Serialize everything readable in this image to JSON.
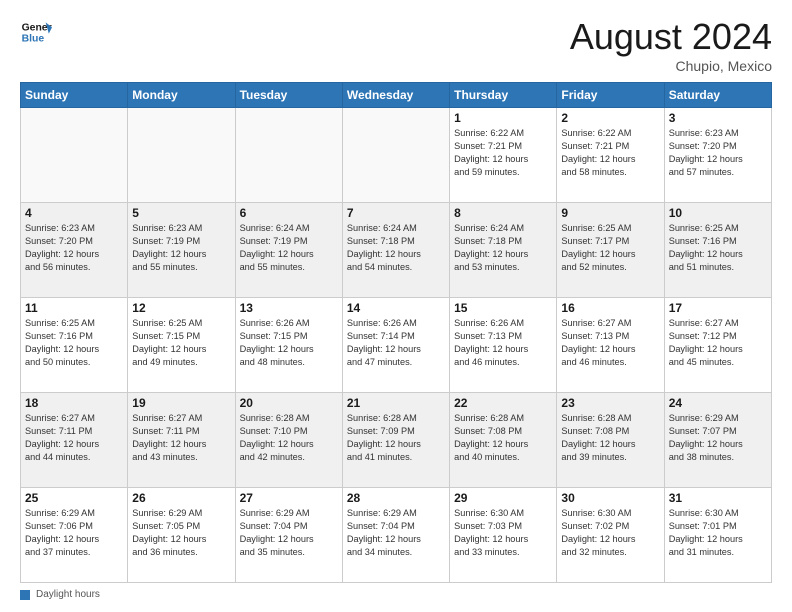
{
  "header": {
    "logo_line1": "General",
    "logo_line2": "Blue",
    "month_title": "August 2024",
    "subtitle": "Chupio, Mexico"
  },
  "days_of_week": [
    "Sunday",
    "Monday",
    "Tuesday",
    "Wednesday",
    "Thursday",
    "Friday",
    "Saturday"
  ],
  "footer": {
    "label": "Daylight hours"
  },
  "weeks": [
    {
      "days": [
        {
          "num": "",
          "info": "",
          "empty": true
        },
        {
          "num": "",
          "info": "",
          "empty": true
        },
        {
          "num": "",
          "info": "",
          "empty": true
        },
        {
          "num": "",
          "info": "",
          "empty": true
        },
        {
          "num": "1",
          "info": "Sunrise: 6:22 AM\nSunset: 7:21 PM\nDaylight: 12 hours\nand 59 minutes."
        },
        {
          "num": "2",
          "info": "Sunrise: 6:22 AM\nSunset: 7:21 PM\nDaylight: 12 hours\nand 58 minutes."
        },
        {
          "num": "3",
          "info": "Sunrise: 6:23 AM\nSunset: 7:20 PM\nDaylight: 12 hours\nand 57 minutes."
        }
      ]
    },
    {
      "days": [
        {
          "num": "4",
          "info": "Sunrise: 6:23 AM\nSunset: 7:20 PM\nDaylight: 12 hours\nand 56 minutes."
        },
        {
          "num": "5",
          "info": "Sunrise: 6:23 AM\nSunset: 7:19 PM\nDaylight: 12 hours\nand 55 minutes."
        },
        {
          "num": "6",
          "info": "Sunrise: 6:24 AM\nSunset: 7:19 PM\nDaylight: 12 hours\nand 55 minutes."
        },
        {
          "num": "7",
          "info": "Sunrise: 6:24 AM\nSunset: 7:18 PM\nDaylight: 12 hours\nand 54 minutes."
        },
        {
          "num": "8",
          "info": "Sunrise: 6:24 AM\nSunset: 7:18 PM\nDaylight: 12 hours\nand 53 minutes."
        },
        {
          "num": "9",
          "info": "Sunrise: 6:25 AM\nSunset: 7:17 PM\nDaylight: 12 hours\nand 52 minutes."
        },
        {
          "num": "10",
          "info": "Sunrise: 6:25 AM\nSunset: 7:16 PM\nDaylight: 12 hours\nand 51 minutes."
        }
      ]
    },
    {
      "days": [
        {
          "num": "11",
          "info": "Sunrise: 6:25 AM\nSunset: 7:16 PM\nDaylight: 12 hours\nand 50 minutes."
        },
        {
          "num": "12",
          "info": "Sunrise: 6:25 AM\nSunset: 7:15 PM\nDaylight: 12 hours\nand 49 minutes."
        },
        {
          "num": "13",
          "info": "Sunrise: 6:26 AM\nSunset: 7:15 PM\nDaylight: 12 hours\nand 48 minutes."
        },
        {
          "num": "14",
          "info": "Sunrise: 6:26 AM\nSunset: 7:14 PM\nDaylight: 12 hours\nand 47 minutes."
        },
        {
          "num": "15",
          "info": "Sunrise: 6:26 AM\nSunset: 7:13 PM\nDaylight: 12 hours\nand 46 minutes."
        },
        {
          "num": "16",
          "info": "Sunrise: 6:27 AM\nSunset: 7:13 PM\nDaylight: 12 hours\nand 46 minutes."
        },
        {
          "num": "17",
          "info": "Sunrise: 6:27 AM\nSunset: 7:12 PM\nDaylight: 12 hours\nand 45 minutes."
        }
      ]
    },
    {
      "days": [
        {
          "num": "18",
          "info": "Sunrise: 6:27 AM\nSunset: 7:11 PM\nDaylight: 12 hours\nand 44 minutes."
        },
        {
          "num": "19",
          "info": "Sunrise: 6:27 AM\nSunset: 7:11 PM\nDaylight: 12 hours\nand 43 minutes."
        },
        {
          "num": "20",
          "info": "Sunrise: 6:28 AM\nSunset: 7:10 PM\nDaylight: 12 hours\nand 42 minutes."
        },
        {
          "num": "21",
          "info": "Sunrise: 6:28 AM\nSunset: 7:09 PM\nDaylight: 12 hours\nand 41 minutes."
        },
        {
          "num": "22",
          "info": "Sunrise: 6:28 AM\nSunset: 7:08 PM\nDaylight: 12 hours\nand 40 minutes."
        },
        {
          "num": "23",
          "info": "Sunrise: 6:28 AM\nSunset: 7:08 PM\nDaylight: 12 hours\nand 39 minutes."
        },
        {
          "num": "24",
          "info": "Sunrise: 6:29 AM\nSunset: 7:07 PM\nDaylight: 12 hours\nand 38 minutes."
        }
      ]
    },
    {
      "days": [
        {
          "num": "25",
          "info": "Sunrise: 6:29 AM\nSunset: 7:06 PM\nDaylight: 12 hours\nand 37 minutes."
        },
        {
          "num": "26",
          "info": "Sunrise: 6:29 AM\nSunset: 7:05 PM\nDaylight: 12 hours\nand 36 minutes."
        },
        {
          "num": "27",
          "info": "Sunrise: 6:29 AM\nSunset: 7:04 PM\nDaylight: 12 hours\nand 35 minutes."
        },
        {
          "num": "28",
          "info": "Sunrise: 6:29 AM\nSunset: 7:04 PM\nDaylight: 12 hours\nand 34 minutes."
        },
        {
          "num": "29",
          "info": "Sunrise: 6:30 AM\nSunset: 7:03 PM\nDaylight: 12 hours\nand 33 minutes."
        },
        {
          "num": "30",
          "info": "Sunrise: 6:30 AM\nSunset: 7:02 PM\nDaylight: 12 hours\nand 32 minutes."
        },
        {
          "num": "31",
          "info": "Sunrise: 6:30 AM\nSunset: 7:01 PM\nDaylight: 12 hours\nand 31 minutes."
        }
      ]
    }
  ]
}
